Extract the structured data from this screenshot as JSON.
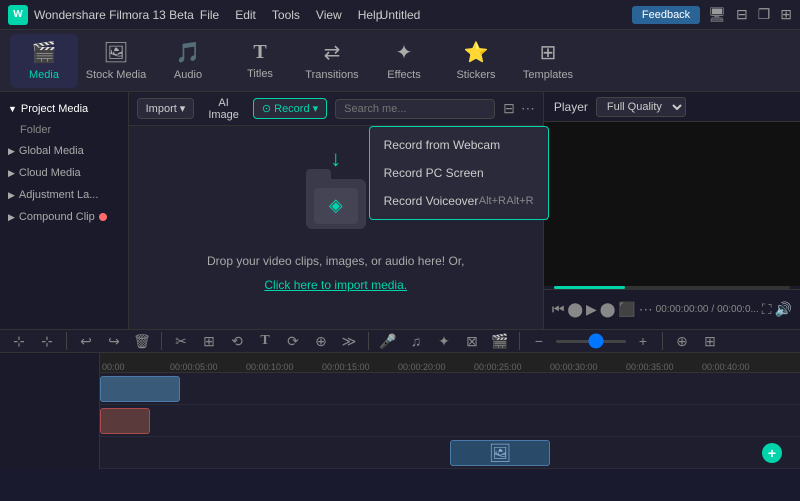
{
  "titleBar": {
    "appName": "Wondershare Filmora 13 Beta",
    "logoText": "W",
    "menuItems": [
      "File",
      "Edit",
      "Tools",
      "View",
      "Help"
    ],
    "title": "Untitled",
    "feedbackBtn": "Feedback",
    "icons": [
      "⬜",
      "⬛",
      "❐",
      "⊞"
    ]
  },
  "toolbar": {
    "items": [
      {
        "id": "media",
        "label": "Media",
        "icon": "🎬",
        "active": true
      },
      {
        "id": "stock-media",
        "label": "Stock Media",
        "icon": "🖼"
      },
      {
        "id": "audio",
        "label": "Audio",
        "icon": "🎵"
      },
      {
        "id": "titles",
        "label": "Titles",
        "icon": "T"
      },
      {
        "id": "transitions",
        "label": "Transitions",
        "icon": "↔"
      },
      {
        "id": "effects",
        "label": "Effects",
        "icon": "✦"
      },
      {
        "id": "stickers",
        "label": "Stickers",
        "icon": "★"
      },
      {
        "id": "templates",
        "label": "Templates",
        "icon": "⊞"
      }
    ]
  },
  "sidebar": {
    "sections": [
      {
        "id": "project-media",
        "label": "Project Media",
        "expanded": true,
        "children": [
          "Folder"
        ]
      },
      {
        "id": "global-media",
        "label": "Global Media",
        "expanded": false
      },
      {
        "id": "cloud-media",
        "label": "Cloud Media",
        "expanded": false
      },
      {
        "id": "adjustment-layer",
        "label": "Adjustment La...",
        "expanded": false
      },
      {
        "id": "compound-clip",
        "label": "Compound Clip",
        "expanded": false,
        "hasDot": true
      }
    ]
  },
  "contentToolbar": {
    "importBtn": "Import",
    "aiImageBtn": "AI Image",
    "recordBtn": "Record",
    "searchPlaceholder": "Search me..."
  },
  "dropdown": {
    "items": [
      {
        "label": "Record from Webcam",
        "shortcut": ""
      },
      {
        "label": "Record PC Screen",
        "shortcut": ""
      },
      {
        "label": "Record Voiceover",
        "shortcut": "Alt+R"
      }
    ]
  },
  "dropZone": {
    "mainText": "Drop your video clips, images, or audio here! Or,",
    "linkText": "Click here to import media."
  },
  "player": {
    "label": "Player",
    "quality": "Full Quality",
    "timeStart": "00:00:00:00",
    "timeSeparator": "/",
    "timeEnd": "00:00:0..."
  },
  "timelineToolbar": {
    "buttons": [
      "↩",
      "↪",
      "🗑",
      "✂",
      "⊞",
      "⟲",
      "T",
      "⟳",
      "⊕",
      "≡",
      "♫",
      "✦",
      "⊠",
      "🎬",
      "−",
      "+",
      "⊕",
      "⊞"
    ]
  },
  "timeline": {
    "ticks": [
      "00:00",
      "00:00:05:00",
      "00:00:10:00",
      "00:00:15:00",
      "00:00:20:00",
      "00:00:25:00",
      "00:00:30:00",
      "00:00:35:00",
      "00:00:40:00"
    ]
  }
}
